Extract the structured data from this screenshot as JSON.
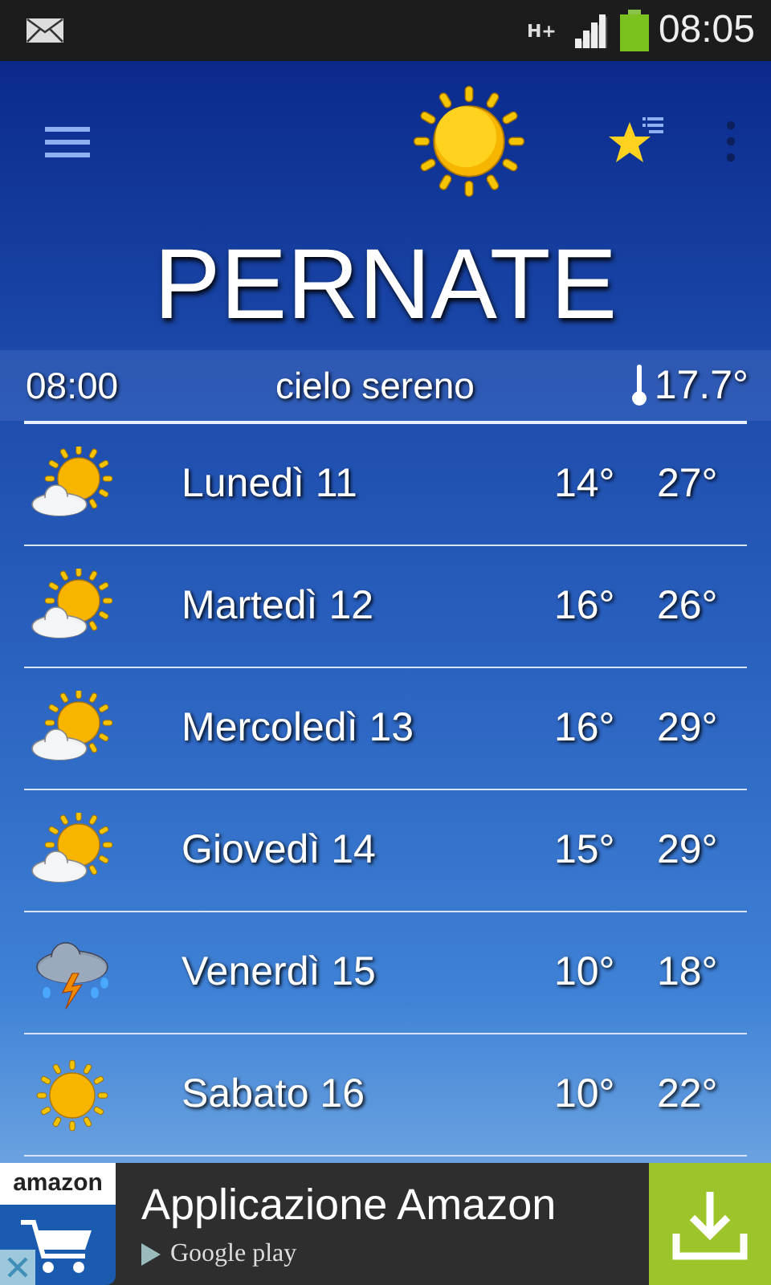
{
  "status_bar": {
    "network": "H+",
    "time": "08:05"
  },
  "header": {
    "city": "PERNATE"
  },
  "current": {
    "time": "08:00",
    "condition": "cielo sereno",
    "temperature": "17.7°"
  },
  "forecast": [
    {
      "day": "Lunedì 11",
      "kind": "sun_cloud",
      "min": "14°",
      "max": "27°"
    },
    {
      "day": "Martedì 12",
      "kind": "sun_cloud",
      "min": "16°",
      "max": "26°"
    },
    {
      "day": "Mercoledì 13",
      "kind": "sun_cloud",
      "min": "16°",
      "max": "29°"
    },
    {
      "day": "Giovedì 14",
      "kind": "sun_cloud",
      "min": "15°",
      "max": "29°"
    },
    {
      "day": "Venerdì 15",
      "kind": "storm",
      "min": "10°",
      "max": "18°"
    },
    {
      "day": "Sabato 16",
      "kind": "sun",
      "min": "10°",
      "max": "22°"
    }
  ],
  "ad": {
    "logo": "amazon",
    "title": "Applicazione Amazon",
    "store": "Google play"
  }
}
